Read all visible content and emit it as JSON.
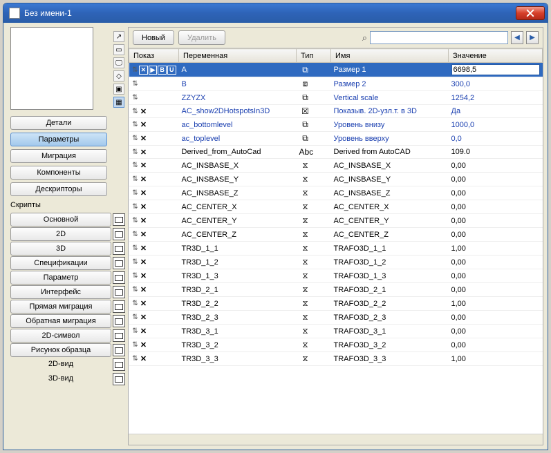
{
  "window": {
    "title": "Без имени-1"
  },
  "toolbar": {
    "new": "Новый",
    "delete": "Удалить"
  },
  "search": {
    "placeholder": ""
  },
  "nav": {
    "details": "Детали",
    "parameters": "Параметры",
    "migration": "Миграция",
    "components": "Компоненты",
    "descriptors": "Дескрипторы"
  },
  "scripts_label": "Скрипты",
  "scripts": {
    "main": "Основной",
    "2d": "2D",
    "3d": "3D",
    "spec": "Спецификации",
    "param": "Параметр",
    "iface": "Интерфейс",
    "fmig": "Прямая миграция",
    "bmig": "Обратная миграция",
    "sym2d": "2D-символ",
    "sample": "Рисунок образца",
    "view2d": "2D-вид",
    "view3d": "3D-вид"
  },
  "headers": {
    "show": "Показ",
    "var": "Переменная",
    "type": "Тип",
    "name": "Имя",
    "value": "Значение"
  },
  "rows": [
    {
      "sel": true,
      "icons": "full",
      "var": "A",
      "type": "dim",
      "name": "Размер 1",
      "value": "6698,5",
      "blue": true
    },
    {
      "icons": "drag",
      "var": "B",
      "type": "dim2",
      "name": "Размер 2",
      "value": "300,0",
      "blue": true
    },
    {
      "icons": "drag",
      "var": "ZZYZX",
      "type": "dim3",
      "name": "Vertical scale",
      "value": "1254,2",
      "blue": true
    },
    {
      "icons": "dx",
      "var": "AC_show2DHotspotsIn3D",
      "type": "chk",
      "name": "Показыв. 2D-узл.т. в 3D",
      "value": "Да",
      "blue": true
    },
    {
      "icons": "dx",
      "var": "ac_bottomlevel",
      "type": "dim3",
      "name": "Уровень внизу",
      "value": "1000,0",
      "blue": true
    },
    {
      "icons": "dx",
      "var": "ac_toplevel",
      "type": "dim3",
      "name": "Уровень вверху",
      "value": "0,0",
      "blue": true
    },
    {
      "icons": "dx",
      "var": "Derived_from_AutoCad",
      "type": "abc",
      "name": "Derived from AutoCAD",
      "value": "109.0"
    },
    {
      "icons": "dx",
      "var": "AC_INSBASE_X",
      "type": "num",
      "name": "AC_INSBASE_X",
      "value": "0,00"
    },
    {
      "icons": "dx",
      "var": "AC_INSBASE_Y",
      "type": "num",
      "name": "AC_INSBASE_Y",
      "value": "0,00"
    },
    {
      "icons": "dx",
      "var": "AC_INSBASE_Z",
      "type": "num",
      "name": "AC_INSBASE_Z",
      "value": "0,00"
    },
    {
      "icons": "dx",
      "var": "AC_CENTER_X",
      "type": "num",
      "name": "AC_CENTER_X",
      "value": "0,00"
    },
    {
      "icons": "dx",
      "var": "AC_CENTER_Y",
      "type": "num",
      "name": "AC_CENTER_Y",
      "value": "0,00"
    },
    {
      "icons": "dx",
      "var": "AC_CENTER_Z",
      "type": "num",
      "name": "AC_CENTER_Z",
      "value": "0,00"
    },
    {
      "icons": "dx",
      "var": "TR3D_1_1",
      "type": "num",
      "name": "TRAFO3D_1_1",
      "value": "1,00"
    },
    {
      "icons": "dx",
      "var": "TR3D_1_2",
      "type": "num",
      "name": "TRAFO3D_1_2",
      "value": "0,00"
    },
    {
      "icons": "dx",
      "var": "TR3D_1_3",
      "type": "num",
      "name": "TRAFO3D_1_3",
      "value": "0,00"
    },
    {
      "icons": "dx",
      "var": "TR3D_2_1",
      "type": "num",
      "name": "TRAFO3D_2_1",
      "value": "0,00"
    },
    {
      "icons": "dx",
      "var": "TR3D_2_2",
      "type": "num",
      "name": "TRAFO3D_2_2",
      "value": "1,00"
    },
    {
      "icons": "dx",
      "var": "TR3D_2_3",
      "type": "num",
      "name": "TRAFO3D_2_3",
      "value": "0,00"
    },
    {
      "icons": "dx",
      "var": "TR3D_3_1",
      "type": "num",
      "name": "TRAFO3D_3_1",
      "value": "0,00"
    },
    {
      "icons": "dx",
      "var": "TR3D_3_2",
      "type": "num",
      "name": "TRAFO3D_3_2",
      "value": "0,00"
    },
    {
      "icons": "dx",
      "var": "TR3D_3_3",
      "type": "num",
      "name": "TRAFO3D_3_3",
      "value": "1,00"
    }
  ]
}
